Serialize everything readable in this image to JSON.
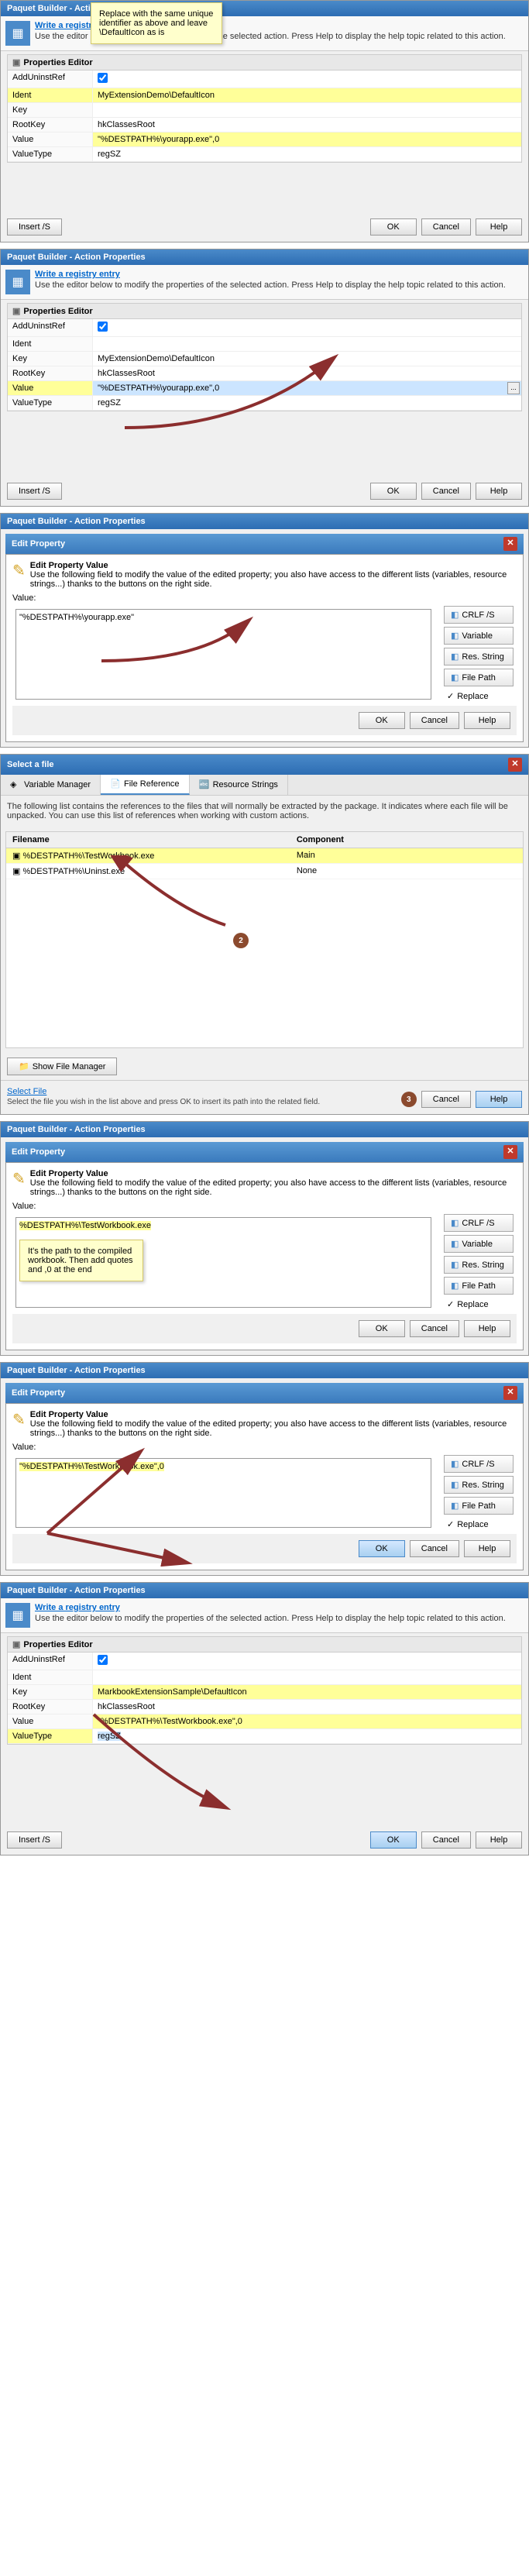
{
  "panels": [
    {
      "title": "Paquet Builder - Action Properties",
      "headerLink": "Write a registry entry",
      "headerDesc": "Use the editor below to modify the properties of the selected action. Press Help to display the help topic related to this action.",
      "sectionTitle": "Properties Editor",
      "rows": {
        "addUninstRef": "AddUninstRef",
        "ident": "Ident",
        "identVal": "MyExtensionDemo\\DefaultIcon",
        "key": "Key",
        "keyVal": "",
        "rootKey": "RootKey",
        "rootKeyVal": "hkClassesRoot",
        "value": "Value",
        "valueVal": "\"%DESTPATH%\\yourapp.exe\",0",
        "valueType": "ValueType",
        "valueTypeVal": "regSZ"
      },
      "callout": "Replace with the same unique identifier as above and leave \\DefaultIcon as is",
      "insertBtn": "Insert /S"
    },
    {
      "title": "Paquet Builder - Action Properties",
      "headerLink": "Write a registry entry",
      "headerDesc": "Use the editor below to modify the properties of the selected action. Press Help to display the help topic related to this action.",
      "sectionTitle": "Properties Editor",
      "rows": {
        "addUninstRef": "AddUninstRef",
        "ident": "Ident",
        "key": "Key",
        "keyVal": "MyExtensionDemo\\DefaultIcon",
        "rootKey": "RootKey",
        "rootKeyVal": "hkClassesRoot",
        "value": "Value",
        "valueVal": "\"%DESTPATH%\\yourapp.exe\",0",
        "valueType": "ValueType",
        "valueTypeVal": "regSZ"
      },
      "insertBtn": "Insert /S"
    }
  ],
  "editDialog": {
    "title": "Paquet Builder - Action Properties",
    "subTitle": "Edit Property",
    "heading": "Edit Property Value",
    "desc": "Use the following field to modify the value of the edited property; you also have access to the different lists (variables, resource strings...) thanks to the buttons on the right side.",
    "valueLabel": "Value:",
    "value1": "\"%DESTPATH%\\yourapp.exe\"",
    "value2": "%DESTPATH%\\TestWorkbook.exe",
    "value3": "\"%DESTPATH%\\TestWorkbook.exe\",0",
    "btns": {
      "crlf": "CRLF /S",
      "variable": "Variable",
      "resString": "Res. String",
      "filePath": "File Path",
      "replace": "Replace"
    },
    "callout": "It's the path to the compiled workbook. Then add quotes and ,0 at the end"
  },
  "selectFile": {
    "title": "Select a file",
    "tabs": {
      "varMgr": "Variable Manager",
      "fileRef": "File Reference",
      "resStr": "Resource Strings"
    },
    "desc": "The following list contains the references to the files that will normally be extracted by the package. It indicates where each file will be unpacked. You can use this list of references when working with custom actions.",
    "cols": {
      "filename": "Filename",
      "component": "Component"
    },
    "files": [
      {
        "name": "%DESTPATH%\\TestWorkbook.exe",
        "comp": "Main"
      },
      {
        "name": "%DESTPATH%\\Uninst.exe",
        "comp": "None"
      }
    ],
    "showFileMgr": "Show File Manager",
    "selectFileHead": "Select File",
    "selectFileDesc": "Select the file you wish in the list above and press OK to insert its path into the related field."
  },
  "finalPanel": {
    "title": "Paquet Builder - Action Properties",
    "headerLink": "Write a registry entry",
    "headerDesc": "Use the editor below to modify the properties of the selected action. Press Help to display the help topic related to this action.",
    "sectionTitle": "Properties Editor",
    "rows": {
      "addUninstRef": "AddUninstRef",
      "ident": "Ident",
      "key": "Key",
      "keyVal": "MarkbookExtensionSample\\DefaultIcon",
      "rootKey": "RootKey",
      "rootKeyVal": "hkClassesRoot",
      "value": "Value",
      "valueVal": "\"%DESTPATH%\\TestWorkbook.exe\",0",
      "valueType": "ValueType",
      "valueTypeVal": "regSZ"
    },
    "insertBtn": "Insert /S"
  },
  "common": {
    "ok": "OK",
    "cancel": "Cancel",
    "help": "Help"
  }
}
